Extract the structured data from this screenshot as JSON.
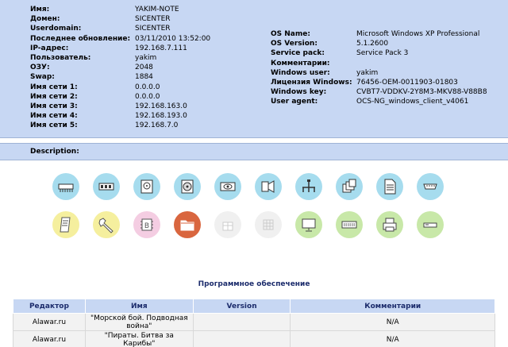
{
  "left_fields": [
    {
      "label": "Имя:",
      "value": "YAKIM-NOTE"
    },
    {
      "label": "Домен:",
      "value": "SICENTER"
    },
    {
      "label": "Userdomain:",
      "value": "SICENTER"
    },
    {
      "label": "Последнее обновление:",
      "value": "03/11/2010 13:52:00"
    },
    {
      "label": "IP-адрес:",
      "value": "192.168.7.111"
    },
    {
      "label": "Пользователь:",
      "value": "yakim"
    },
    {
      "label": "ОЗУ:",
      "value": "2048"
    },
    {
      "label": "Swap:",
      "value": "1884"
    },
    {
      "label": "Имя сети 1:",
      "value": "0.0.0.0"
    },
    {
      "label": "Имя сети 2:",
      "value": "0.0.0.0"
    },
    {
      "label": "Имя сети 3:",
      "value": "192.168.163.0"
    },
    {
      "label": "Имя сети 4:",
      "value": "192.168.193.0"
    },
    {
      "label": "Имя сети 5:",
      "value": "192.168.7.0"
    }
  ],
  "right_fields": [
    {
      "label": "OS Name:",
      "value": "Microsoft Windows XP Professional"
    },
    {
      "label": "OS Version:",
      "value": "5.1.2600"
    },
    {
      "label": "Service pack:",
      "value": "Service Pack 3"
    },
    {
      "label": "Комментарии:",
      "value": ""
    },
    {
      "label": "Windows user:",
      "value": "yakim"
    },
    {
      "label": "Лицензия Windows:",
      "value": "76456-OEM-0011903-01803"
    },
    {
      "label": "Windows key:",
      "value": "CVBT7-VDDKV-2Y8M3-MKV88-V88B8"
    },
    {
      "label": "User agent:",
      "value": "OCS-NG_windows_client_v4061"
    }
  ],
  "description_label": "Description:",
  "icons_row1": [
    {
      "name": "memory-slots-icon",
      "color": "cyan"
    },
    {
      "name": "memory-module-icon",
      "color": "cyan"
    },
    {
      "name": "hard-disk-icon",
      "color": "cyan"
    },
    {
      "name": "drives-icon",
      "color": "cyan"
    },
    {
      "name": "video-card-icon",
      "color": "cyan"
    },
    {
      "name": "sound-icon",
      "color": "cyan"
    },
    {
      "name": "network-icon",
      "color": "cyan"
    },
    {
      "name": "controllers-icon",
      "color": "cyan"
    },
    {
      "name": "printer-docs-icon",
      "color": "cyan"
    },
    {
      "name": "ports-icon",
      "color": "cyan"
    }
  ],
  "icons_row2": [
    {
      "name": "registry-icon",
      "color": "yellow"
    },
    {
      "name": "tools-icon",
      "color": "yellow"
    },
    {
      "name": "bios-chip-icon",
      "color": "pink"
    },
    {
      "name": "software-folder-icon",
      "color": "orange"
    },
    {
      "name": "gift-icon",
      "color": "grey"
    },
    {
      "name": "grid-icon",
      "color": "grey"
    },
    {
      "name": "monitor-icon",
      "color": "green"
    },
    {
      "name": "keyboard-icon",
      "color": "green"
    },
    {
      "name": "printer-icon",
      "color": "green"
    },
    {
      "name": "modem-icon",
      "color": "green"
    }
  ],
  "software_title": "Программное обеспечение",
  "table": {
    "headers": [
      "Редактор",
      "Имя",
      "Version",
      "Комментарии"
    ],
    "rows": [
      {
        "publisher": "Alawar.ru",
        "name": "\"Морской бой. Подводная война\"",
        "version": "",
        "comment": "N/A"
      },
      {
        "publisher": "Alawar.ru",
        "name": "\"Пираты. Битва за Карибы\"",
        "version": "",
        "comment": "N/A"
      }
    ]
  }
}
